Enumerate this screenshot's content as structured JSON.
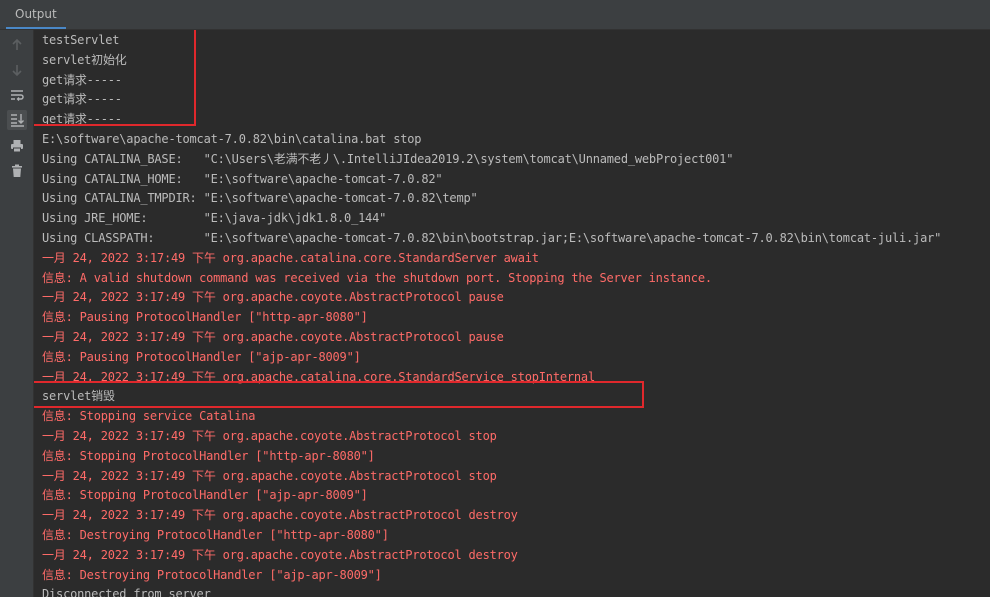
{
  "tab": {
    "label": "Output"
  },
  "toolbar": {
    "items": [
      {
        "name": "up-arrow-icon"
      },
      {
        "name": "down-arrow-icon"
      },
      {
        "name": "soft-wrap-icon"
      },
      {
        "name": "scroll-to-end-icon"
      },
      {
        "name": "print-icon"
      },
      {
        "name": "trash-icon"
      }
    ]
  },
  "console": {
    "lines": [
      {
        "text": "testServlet",
        "type": "out"
      },
      {
        "text": "servlet初始化",
        "type": "out"
      },
      {
        "text": "get请求-----",
        "type": "out"
      },
      {
        "text": "get请求-----",
        "type": "out"
      },
      {
        "text": "get请求-----",
        "type": "out"
      },
      {
        "text": "E:\\software\\apache-tomcat-7.0.82\\bin\\catalina.bat stop",
        "type": "out"
      },
      {
        "text": "Using CATALINA_BASE:   \"C:\\Users\\老满不老丿\\.IntelliJIdea2019.2\\system\\tomcat\\Unnamed_webProject001\"",
        "type": "out"
      },
      {
        "text": "Using CATALINA_HOME:   \"E:\\software\\apache-tomcat-7.0.82\"",
        "type": "out"
      },
      {
        "text": "Using CATALINA_TMPDIR: \"E:\\software\\apache-tomcat-7.0.82\\temp\"",
        "type": "out"
      },
      {
        "text": "Using JRE_HOME:        \"E:\\java-jdk\\jdk1.8.0_144\"",
        "type": "out"
      },
      {
        "text": "Using CLASSPATH:       \"E:\\software\\apache-tomcat-7.0.82\\bin\\bootstrap.jar;E:\\software\\apache-tomcat-7.0.82\\bin\\tomcat-juli.jar\"",
        "type": "out"
      },
      {
        "text": "一月 24, 2022 3:17:49 下午 org.apache.catalina.core.StandardServer await",
        "type": "err"
      },
      {
        "text": "信息: A valid shutdown command was received via the shutdown port. Stopping the Server instance.",
        "type": "err"
      },
      {
        "text": "一月 24, 2022 3:17:49 下午 org.apache.coyote.AbstractProtocol pause",
        "type": "err"
      },
      {
        "text": "信息: Pausing ProtocolHandler [\"http-apr-8080\"]",
        "type": "err"
      },
      {
        "text": "一月 24, 2022 3:17:49 下午 org.apache.coyote.AbstractProtocol pause",
        "type": "err"
      },
      {
        "text": "信息: Pausing ProtocolHandler [\"ajp-apr-8009\"]",
        "type": "err"
      },
      {
        "text": "一月 24, 2022 3:17:49 下午 org.apache.catalina.core.StandardService stopInternal",
        "type": "err"
      },
      {
        "text": "servlet销毁",
        "type": "out"
      },
      {
        "text": "信息: Stopping service Catalina",
        "type": "err"
      },
      {
        "text": "一月 24, 2022 3:17:49 下午 org.apache.coyote.AbstractProtocol stop",
        "type": "err"
      },
      {
        "text": "信息: Stopping ProtocolHandler [\"http-apr-8080\"]",
        "type": "err"
      },
      {
        "text": "一月 24, 2022 3:17:49 下午 org.apache.coyote.AbstractProtocol stop",
        "type": "err"
      },
      {
        "text": "信息: Stopping ProtocolHandler [\"ajp-apr-8009\"]",
        "type": "err"
      },
      {
        "text": "一月 24, 2022 3:17:49 下午 org.apache.coyote.AbstractProtocol destroy",
        "type": "err"
      },
      {
        "text": "信息: Destroying ProtocolHandler [\"http-apr-8080\"]",
        "type": "err"
      },
      {
        "text": "一月 24, 2022 3:17:49 下午 org.apache.coyote.AbstractProtocol destroy",
        "type": "err"
      },
      {
        "text": "信息: Destroying ProtocolHandler [\"ajp-apr-8009\"]",
        "type": "err"
      },
      {
        "text": "Disconnected from server",
        "type": "out"
      }
    ]
  },
  "colors": {
    "background": "#2b2b2b",
    "panel": "#3c3f41",
    "stdout": "#bbbbbb",
    "stderr": "#ff6b68",
    "highlight": "#e0282c",
    "tab_underline": "#4a88c7"
  }
}
